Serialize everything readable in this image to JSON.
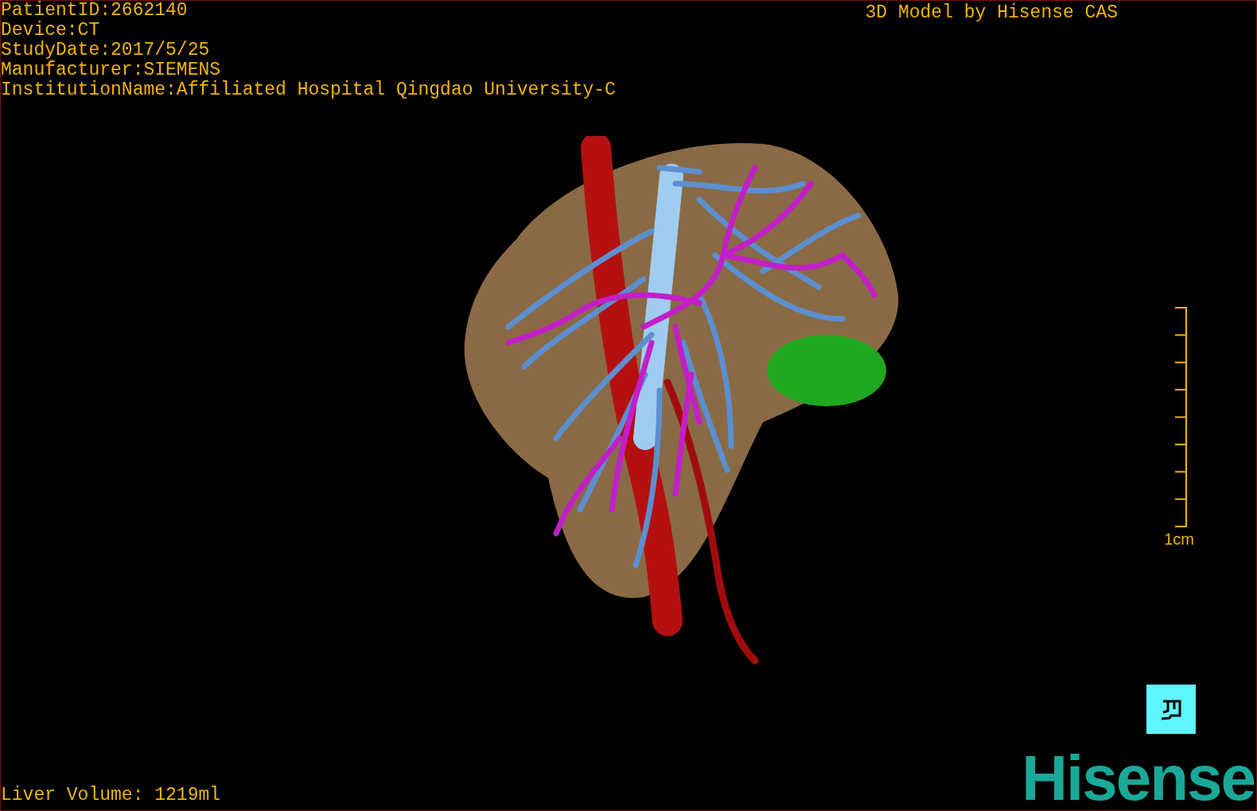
{
  "header": {
    "info_lines": [
      "PatientID:2662140",
      "Device:CT",
      "StudyDate:2017/5/25",
      "Manufacturer:SIEMENS",
      "InstitutionName:Affiliated Hospital Qingdao University-C"
    ],
    "title": "3D Model by Hisense CAS"
  },
  "scale_bar": {
    "label": "1cm"
  },
  "footer": {
    "liver_volume": "Liver Volume: 1219ml",
    "logo": "Hisense"
  }
}
